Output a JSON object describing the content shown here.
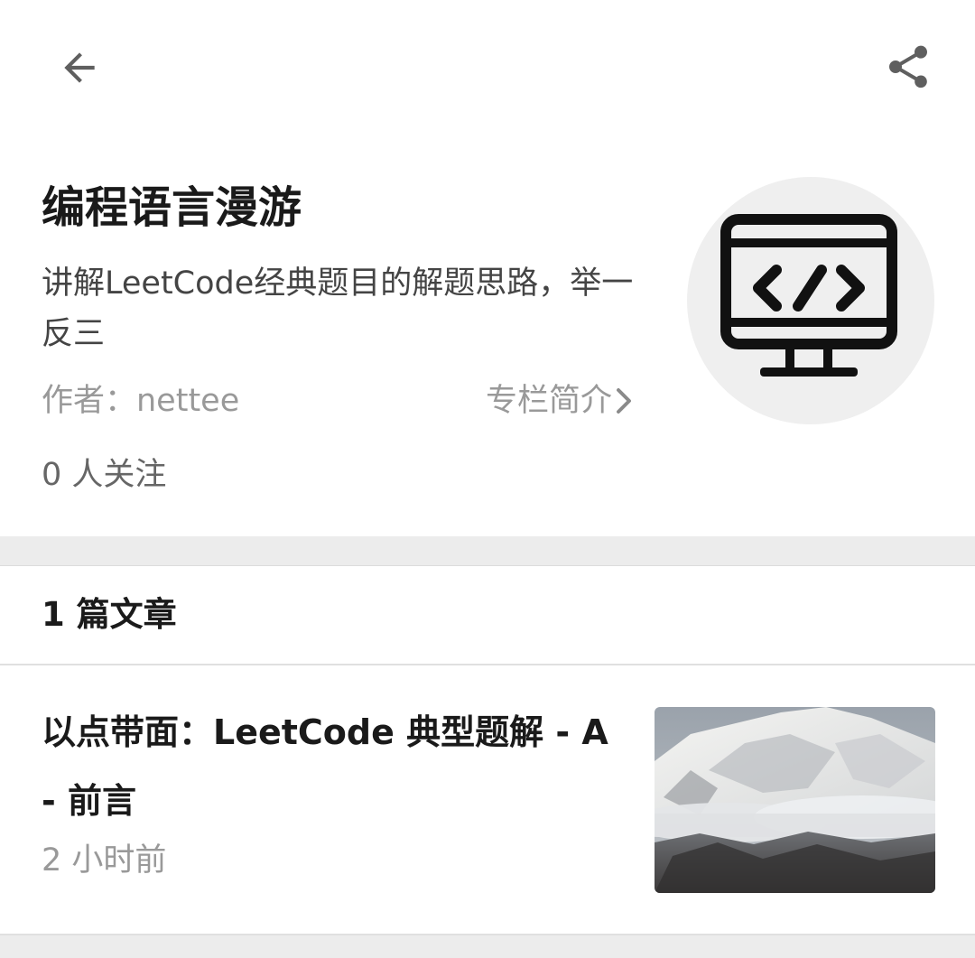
{
  "column": {
    "title": "编程语言漫游",
    "description": "讲解LeetCode经典题目的解题思路，举一反三",
    "author": "作者：nettee",
    "intro_link": "专栏简介",
    "followers": "0 人关注",
    "avatar_icon": "code-monitor-icon"
  },
  "article_list": {
    "count_label": "1 篇文章",
    "articles": [
      {
        "title": "以点带面：LeetCode 典型题解 - A - 前言",
        "time": "2 小时前",
        "thumbnail": "snowy-mountain-image"
      }
    ]
  },
  "colors": {
    "title": "#1a1a1a",
    "secondary": "#999999",
    "divider": "#ececec",
    "avatar_bg": "#efefef"
  }
}
